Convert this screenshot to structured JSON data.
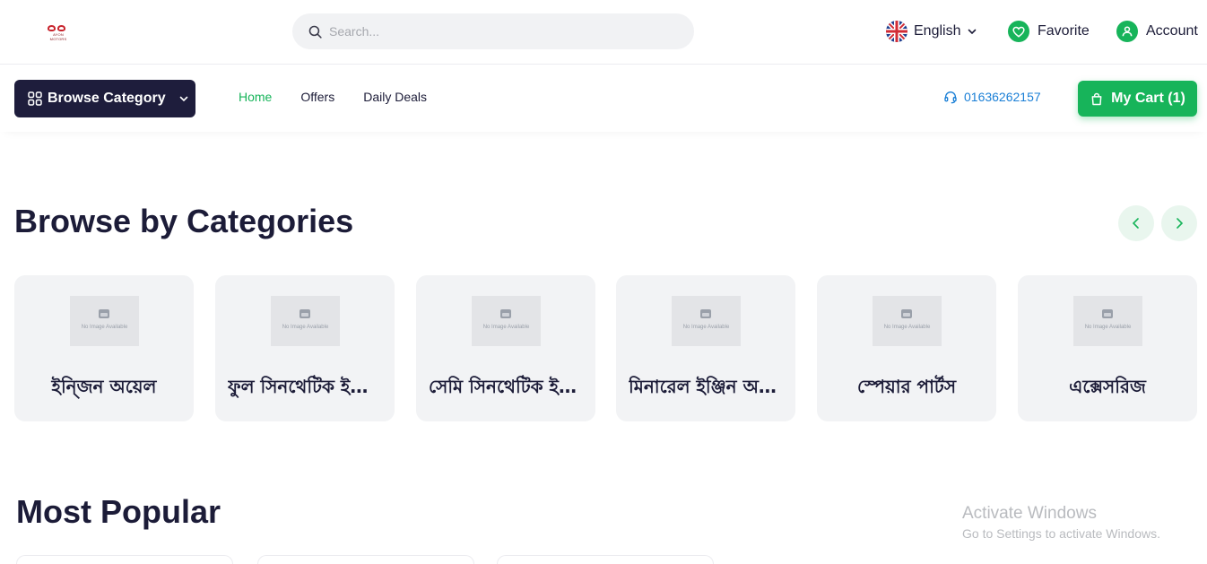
{
  "header": {
    "logo_text": "AYON MOTORS",
    "search_placeholder": "Search...",
    "language": "English",
    "favorite_label": "Favorite",
    "account_label": "Account"
  },
  "nav": {
    "browse_label": "Browse Category",
    "links": [
      "Home",
      "Offers",
      "Daily Deals"
    ],
    "active_link": "Home",
    "phone": "01636262157",
    "cart_label": "My Cart (1)"
  },
  "categories_section": {
    "title": "Browse by Categories",
    "placeholder_text": "No Image Available",
    "items": [
      "ইন্জিন অয়েল",
      "ফুল সিনথেটিক ইঞ্জিন অয়েল",
      "সেমি সিনথেটিক ইঞ্জিন অয়েল",
      "মিনারেল ইঞ্জিন অয়েল",
      "স্পেয়ার পার্টস",
      "এক্সেসরিজ"
    ]
  },
  "popular_section": {
    "title": "Most Popular"
  },
  "watermark": {
    "line1": "Activate Windows",
    "line2": "Go to Settings to activate Windows."
  },
  "colors": {
    "brand_green": "#17b45a",
    "dark_navy": "#1e1d3c",
    "phone_blue": "#1a7fd6"
  }
}
